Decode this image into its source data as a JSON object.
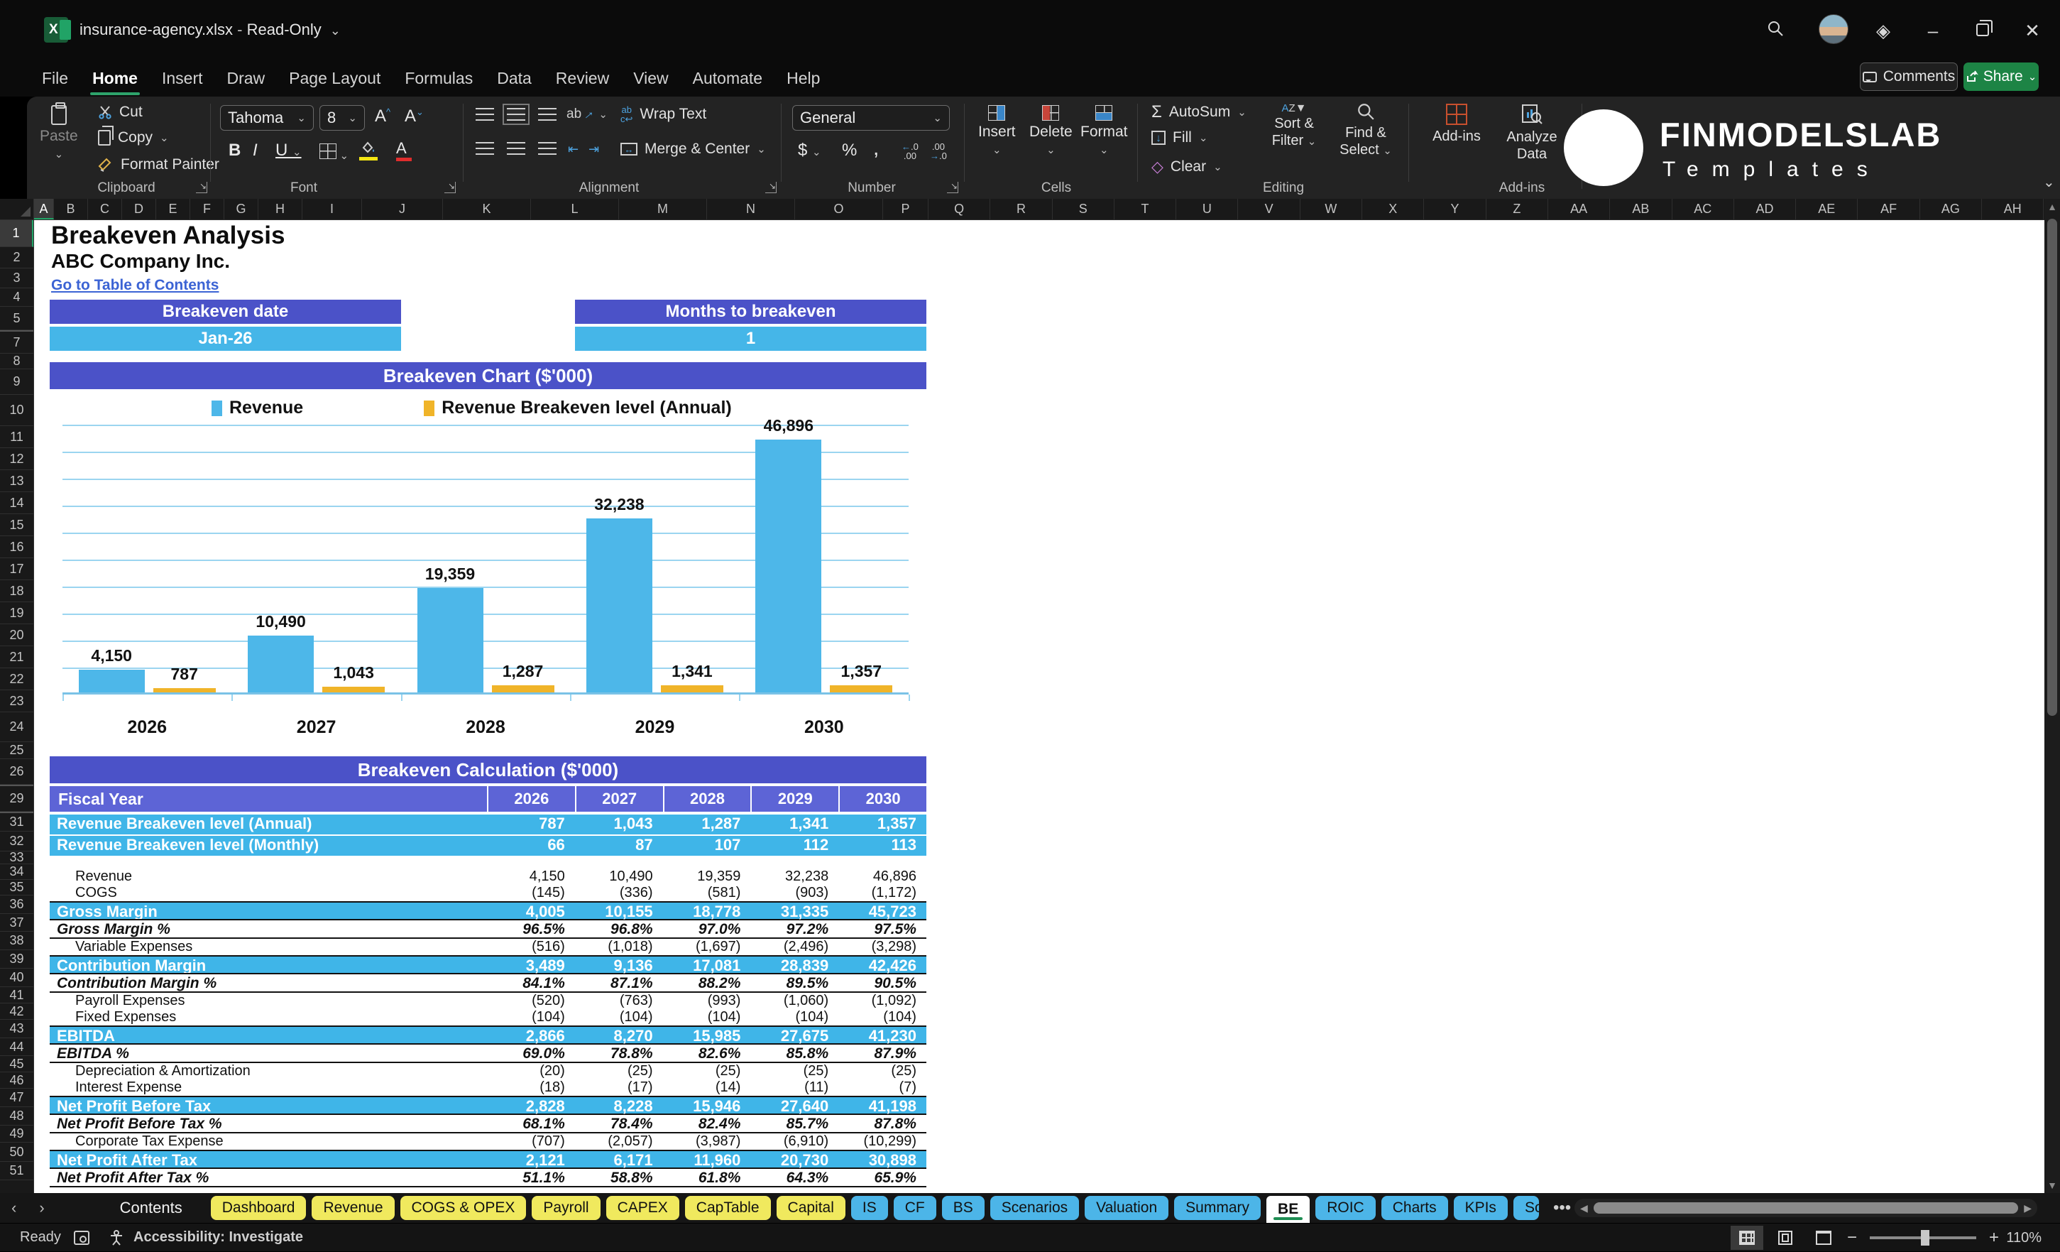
{
  "window": {
    "title": "insurance-agency.xlsx",
    "mode": "Read-Only"
  },
  "menu": {
    "items": [
      "File",
      "Home",
      "Insert",
      "Draw",
      "Page Layout",
      "Formulas",
      "Data",
      "Review",
      "View",
      "Automate",
      "Help"
    ],
    "active": "Home",
    "comments_label": "Comments",
    "share_label": "Share"
  },
  "ribbon": {
    "paste": "Paste",
    "cut": "Cut",
    "copy": "Copy",
    "format_painter": "Format Painter",
    "clipboard_group": "Clipboard",
    "font_name": "Tahoma",
    "font_size": "8",
    "font_group": "Font",
    "wrap_text": "Wrap Text",
    "merge_center": "Merge & Center",
    "alignment_group": "Alignment",
    "number_format": "General",
    "number_group": "Number",
    "insert": "Insert",
    "delete": "Delete",
    "format": "Format",
    "cells_group": "Cells",
    "autosum": "AutoSum",
    "fill": "Fill",
    "clear": "Clear",
    "sort_filter": "Sort & Filter",
    "find_select": "Find & Select",
    "editing_group": "Editing",
    "addins": "Add-ins",
    "analyze_data": "Analyze Data",
    "addins_group": "Add-ins",
    "logo_title": "FINMODELSLAB",
    "logo_subtitle": "Templates"
  },
  "grid": {
    "columns": [
      "A",
      "B",
      "C",
      "D",
      "E",
      "F",
      "G",
      "H",
      "I",
      "J",
      "K",
      "L",
      "M",
      "N",
      "O",
      "P",
      "Q",
      "R",
      "S",
      "T",
      "U",
      "V",
      "W",
      "X",
      "Y",
      "Z",
      "AA",
      "AB",
      "AC",
      "AD",
      "AE",
      "AF",
      "AG",
      "AH"
    ],
    "selected_column": "A",
    "rows": [
      "1",
      "2",
      "3",
      "4",
      "5",
      "7",
      "8",
      "9",
      "10",
      "11",
      "12",
      "13",
      "14",
      "15",
      "16",
      "17",
      "18",
      "19",
      "20",
      "21",
      "22",
      "23",
      "24",
      "25",
      "26",
      "29",
      "31",
      "32",
      "33",
      "34",
      "35",
      "36",
      "37",
      "38",
      "39",
      "40",
      "41",
      "42",
      "43",
      "44",
      "45",
      "46",
      "47",
      "48",
      "49",
      "50",
      "51"
    ],
    "selected_row": "1"
  },
  "sheet": {
    "title": "Breakeven Analysis",
    "company": "ABC Company Inc.",
    "link": "Go to Table of Contents",
    "kpi1": {
      "label": "Breakeven date",
      "value": "Jan-26"
    },
    "kpi2": {
      "label": "Months to breakeven",
      "value": "1"
    }
  },
  "chart_data": {
    "type": "bar",
    "title": "Breakeven Chart ($'000)",
    "categories": [
      "2026",
      "2027",
      "2028",
      "2029",
      "2030"
    ],
    "series": [
      {
        "name": "Revenue",
        "color": "#4db7e9",
        "values": [
          4150,
          10490,
          19359,
          32238,
          46896
        ],
        "labels": [
          "4,150",
          "10,490",
          "19,359",
          "32,238",
          "46,896"
        ]
      },
      {
        "name": "Revenue Breakeven level (Annual)",
        "color": "#f0b429",
        "values": [
          787,
          1043,
          1287,
          1341,
          1357
        ],
        "labels": [
          "787",
          "1,043",
          "1,287",
          "1,341",
          "1,357"
        ]
      }
    ],
    "ylim": [
      0,
      50000
    ],
    "gridline_step": 5000,
    "grid": true,
    "y_axis_labels": false,
    "legend_position": "top"
  },
  "table": {
    "title": "Breakeven Calculation ($'000)",
    "header": {
      "label": "Fiscal Year",
      "years": [
        "2026",
        "2027",
        "2028",
        "2029",
        "2030"
      ]
    },
    "rows": [
      {
        "label": "Revenue Breakeven level (Annual)",
        "type": "blue",
        "values": [
          "787",
          "1,043",
          "1,287",
          "1,341",
          "1,357"
        ]
      },
      {
        "label": "Revenue Breakeven level (Monthly)",
        "type": "blue",
        "values": [
          "66",
          "87",
          "107",
          "112",
          "113"
        ]
      },
      {
        "type": "spacer",
        "label": "",
        "values": []
      },
      {
        "label": "Revenue",
        "type": "item",
        "values": [
          "4,150",
          "10,490",
          "19,359",
          "32,238",
          "46,896"
        ]
      },
      {
        "label": "COGS",
        "type": "item",
        "values": [
          "(145)",
          "(336)",
          "(581)",
          "(903)",
          "(1,172)"
        ]
      },
      {
        "label": "Gross Margin",
        "type": "band",
        "values": [
          "4,005",
          "10,155",
          "18,778",
          "31,335",
          "45,723"
        ]
      },
      {
        "label": "Gross Margin %",
        "type": "pct",
        "values": [
          "96.5%",
          "96.8%",
          "97.0%",
          "97.2%",
          "97.5%"
        ]
      },
      {
        "label": "Variable Expenses",
        "type": "item",
        "values": [
          "(516)",
          "(1,018)",
          "(1,697)",
          "(2,496)",
          "(3,298)"
        ]
      },
      {
        "label": "Contribution Margin",
        "type": "band",
        "values": [
          "3,489",
          "9,136",
          "17,081",
          "28,839",
          "42,426"
        ]
      },
      {
        "label": "Contribution Margin %",
        "type": "pct",
        "values": [
          "84.1%",
          "87.1%",
          "88.2%",
          "89.5%",
          "90.5%"
        ]
      },
      {
        "label": "Payroll Expenses",
        "type": "item",
        "values": [
          "(520)",
          "(763)",
          "(993)",
          "(1,060)",
          "(1,092)"
        ]
      },
      {
        "label": "Fixed Expenses",
        "type": "item",
        "values": [
          "(104)",
          "(104)",
          "(104)",
          "(104)",
          "(104)"
        ]
      },
      {
        "label": "EBITDA",
        "type": "band",
        "values": [
          "2,866",
          "8,270",
          "15,985",
          "27,675",
          "41,230"
        ]
      },
      {
        "label": "EBITDA %",
        "type": "pct",
        "values": [
          "69.0%",
          "78.8%",
          "82.6%",
          "85.8%",
          "87.9%"
        ]
      },
      {
        "label": "Depreciation & Amortization",
        "type": "item",
        "values": [
          "(20)",
          "(25)",
          "(25)",
          "(25)",
          "(25)"
        ]
      },
      {
        "label": "Interest Expense",
        "type": "item",
        "values": [
          "(18)",
          "(17)",
          "(14)",
          "(11)",
          "(7)"
        ]
      },
      {
        "label": "Net Profit Before Tax",
        "type": "band",
        "values": [
          "2,828",
          "8,228",
          "15,946",
          "27,640",
          "41,198"
        ]
      },
      {
        "label": "Net Profit Before Tax %",
        "type": "pct",
        "values": [
          "68.1%",
          "78.4%",
          "82.4%",
          "85.7%",
          "87.8%"
        ]
      },
      {
        "label": "Corporate Tax Expense",
        "type": "item",
        "values": [
          "(707)",
          "(2,057)",
          "(3,987)",
          "(6,910)",
          "(10,299)"
        ]
      },
      {
        "label": "Net Profit After Tax",
        "type": "band",
        "values": [
          "2,121",
          "6,171",
          "11,960",
          "20,730",
          "30,898"
        ]
      },
      {
        "label": "Net Profit After Tax %",
        "type": "pct",
        "values": [
          "51.1%",
          "58.8%",
          "61.8%",
          "64.3%",
          "65.9%"
        ]
      }
    ]
  },
  "tabs": {
    "contents": "Contents",
    "items": [
      {
        "label": "Dashboard",
        "color": "yellow"
      },
      {
        "label": "Revenue",
        "color": "yellow"
      },
      {
        "label": "COGS & OPEX",
        "color": "yellow"
      },
      {
        "label": "Payroll",
        "color": "yellow"
      },
      {
        "label": "CAPEX",
        "color": "yellow"
      },
      {
        "label": "CapTable",
        "color": "yellow"
      },
      {
        "label": "Capital",
        "color": "yellow"
      },
      {
        "label": "IS",
        "color": "blue"
      },
      {
        "label": "CF",
        "color": "blue"
      },
      {
        "label": "BS",
        "color": "blue"
      },
      {
        "label": "Scenarios",
        "color": "blue"
      },
      {
        "label": "Valuation",
        "color": "blue"
      },
      {
        "label": "Summary",
        "color": "blue"
      },
      {
        "label": "BE",
        "color": "active"
      },
      {
        "label": "ROIC",
        "color": "blue"
      },
      {
        "label": "Charts",
        "color": "blue"
      },
      {
        "label": "KPIs",
        "color": "blue"
      },
      {
        "label": "Sc",
        "color": "blue clipped"
      }
    ]
  },
  "status": {
    "ready": "Ready",
    "accessibility": "Accessibility: Investigate",
    "zoom_level": "110%"
  },
  "colors": {
    "header_purple": "#4b52c8",
    "fiscal_purple": "#5d64d6",
    "band_cyan": "#3fb5e8",
    "chart_blue": "#4db7e9",
    "chart_gold": "#f0b429",
    "tab_yellow": "#f0e95e",
    "tab_blue": "#4cb5e8",
    "share_green": "#1d8445",
    "accent_green": "#21a366"
  }
}
